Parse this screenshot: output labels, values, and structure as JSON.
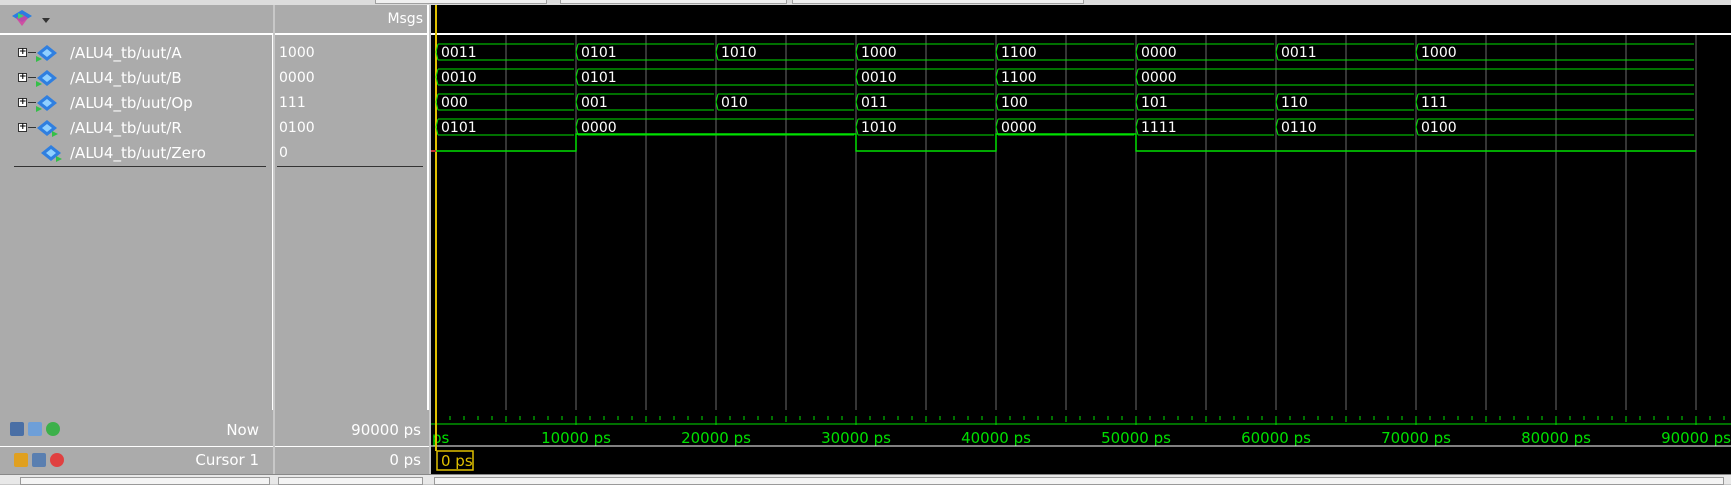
{
  "header": {
    "msgs_title": "Msgs"
  },
  "signals": [
    {
      "name": "/ALU4_tb/uut/A",
      "value": "1000",
      "expandable": true,
      "direction": "in"
    },
    {
      "name": "/ALU4_tb/uut/B",
      "value": "0000",
      "expandable": true,
      "direction": "in"
    },
    {
      "name": "/ALU4_tb/uut/Op",
      "value": "111",
      "expandable": true,
      "direction": "in"
    },
    {
      "name": "/ALU4_tb/uut/R",
      "value": "0100",
      "expandable": true,
      "direction": "out"
    },
    {
      "name": "/ALU4_tb/uut/Zero",
      "value": "0",
      "expandable": false,
      "direction": "out"
    }
  ],
  "waves": {
    "time_max_ps": 90000,
    "buses": [
      {
        "signal": "A",
        "segments": [
          [
            0,
            "0011"
          ],
          [
            10000,
            "0101"
          ],
          [
            20000,
            "1010"
          ],
          [
            30000,
            "1000"
          ],
          [
            40000,
            "1100"
          ],
          [
            50000,
            "0000"
          ],
          [
            60000,
            "0011"
          ],
          [
            70000,
            "1000"
          ]
        ]
      },
      {
        "signal": "B",
        "segments": [
          [
            0,
            "0010"
          ],
          [
            10000,
            "0101"
          ],
          [
            30000,
            "0010"
          ],
          [
            40000,
            "1100"
          ],
          [
            50000,
            "0000"
          ]
        ]
      },
      {
        "signal": "Op",
        "segments": [
          [
            0,
            "000"
          ],
          [
            10000,
            "001"
          ],
          [
            20000,
            "010"
          ],
          [
            30000,
            "011"
          ],
          [
            40000,
            "100"
          ],
          [
            50000,
            "101"
          ],
          [
            60000,
            "110"
          ],
          [
            70000,
            "111"
          ]
        ]
      },
      {
        "signal": "R",
        "segments": [
          [
            0,
            "0101"
          ],
          [
            10000,
            "0000"
          ],
          [
            30000,
            "1010"
          ],
          [
            40000,
            "0000"
          ],
          [
            50000,
            "1111"
          ],
          [
            60000,
            "0110"
          ],
          [
            70000,
            "0100"
          ]
        ]
      }
    ],
    "zero_wave": [
      [
        0,
        0
      ],
      [
        10000,
        1
      ],
      [
        30000,
        0
      ],
      [
        40000,
        1
      ],
      [
        50000,
        0
      ]
    ],
    "wave_color": "#00e000"
  },
  "timeline": {
    "ticks": [
      "ps",
      "10000 ps",
      "20000 ps",
      "30000 ps",
      "40000 ps",
      "50000 ps",
      "60000 ps",
      "70000 ps",
      "80000 ps",
      "90000 ps"
    ]
  },
  "footer": {
    "now_label": "Now",
    "now_value": "90000 ps",
    "cursor_label": "Cursor 1",
    "cursor_value": "0 ps",
    "cursor_tag": "0 ps"
  },
  "colors": {
    "accent_cursor": "#e0c000",
    "pane_bg": "#ababab",
    "wave_bg": "#000000"
  }
}
